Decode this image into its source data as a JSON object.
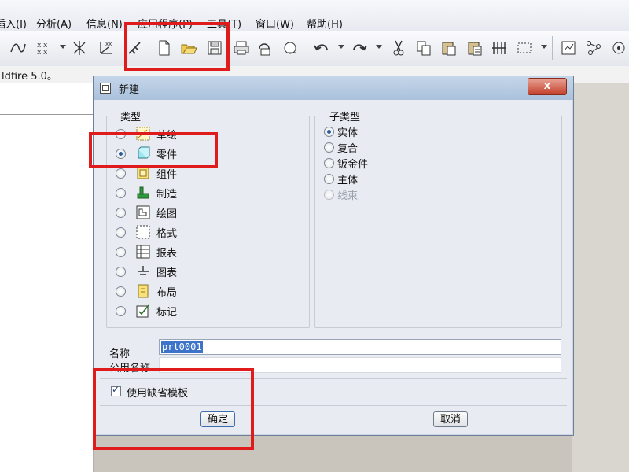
{
  "menubar": {
    "items": [
      "插入(I)",
      "分析(A)",
      "信息(N)",
      "应用程序(P)",
      "工具(T)",
      "窗口(W)",
      "帮助(H)"
    ]
  },
  "toolbar": {
    "icons": [
      "sketch-curve-icon",
      "points-icon",
      "datum-axis-icon",
      "coordinate-system-icon",
      "analysis-icon",
      "new-file-icon",
      "open-folder-icon",
      "save-icon",
      "print-icon",
      "send-mail-icon",
      "email-attach-icon",
      "undo-icon",
      "redo-icon",
      "cut-icon",
      "copy-icon",
      "paste-icon",
      "paste-special-icon",
      "regenerate-icon",
      "select-box-icon",
      "datum-plane-icon",
      "sketch-icon",
      "model-tree-icon"
    ]
  },
  "message_bar": {
    "text": "ldfire 5.0。"
  },
  "dialog": {
    "title": "新建",
    "close_label": "x",
    "type_group_label": "类型",
    "subtype_group_label": "子类型",
    "types": [
      {
        "label": "草绘",
        "icon": "sketch-icon",
        "selected": false
      },
      {
        "label": "零件",
        "icon": "part-icon",
        "selected": true
      },
      {
        "label": "组件",
        "icon": "assembly-icon",
        "selected": false
      },
      {
        "label": "制造",
        "icon": "manufacturing-icon",
        "selected": false
      },
      {
        "label": "绘图",
        "icon": "drawing-icon",
        "selected": false
      },
      {
        "label": "格式",
        "icon": "format-icon",
        "selected": false
      },
      {
        "label": "报表",
        "icon": "report-icon",
        "selected": false
      },
      {
        "label": "图表",
        "icon": "diagram-icon",
        "selected": false
      },
      {
        "label": "布局",
        "icon": "layout-icon",
        "selected": false
      },
      {
        "label": "标记",
        "icon": "markup-icon",
        "selected": false
      }
    ],
    "subtypes": [
      {
        "label": "实体",
        "selected": true,
        "enabled": true
      },
      {
        "label": "复合",
        "selected": false,
        "enabled": true
      },
      {
        "label": "钣金件",
        "selected": false,
        "enabled": true
      },
      {
        "label": "主体",
        "selected": false,
        "enabled": true
      },
      {
        "label": "线束",
        "selected": false,
        "enabled": false
      }
    ],
    "name_label": "名称",
    "name_value": "prt0001",
    "common_name_label": "公用名称",
    "common_name_value": "",
    "use_default_template_label": "使用缺省模板",
    "use_default_template_checked": true,
    "ok_label": "确定",
    "cancel_label": "取消"
  },
  "colors": {
    "annotation_red": "#e01b1b",
    "selection_blue": "#3d74c9"
  }
}
